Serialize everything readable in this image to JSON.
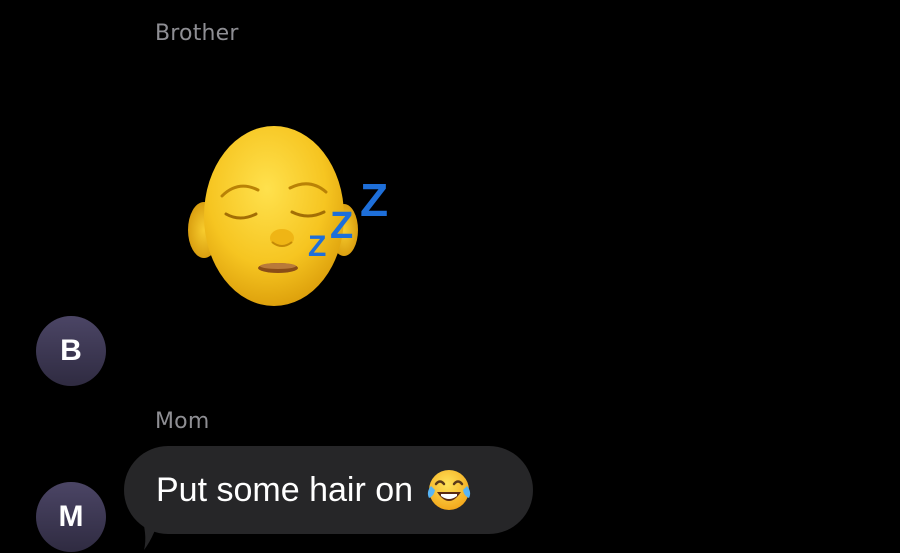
{
  "messages": [
    {
      "sender": "Brother",
      "avatar_initial": "B",
      "content_type": "memoji-sticker",
      "sticker": "sleeping-bald-memoji-icon",
      "sticker_text": "Zzz"
    },
    {
      "sender": "Mom",
      "avatar_initial": "M",
      "content_type": "text",
      "text": "Put some hair on",
      "emoji": "face-with-tears-of-joy-icon"
    }
  ],
  "colors": {
    "background": "#000000",
    "sender_name": "#8e8e93",
    "bubble": "#262628",
    "bubble_text": "#ffffff",
    "avatar": "#3c3752",
    "zzz": "#1e6fd9",
    "memoji_skin": "#f6c521"
  }
}
